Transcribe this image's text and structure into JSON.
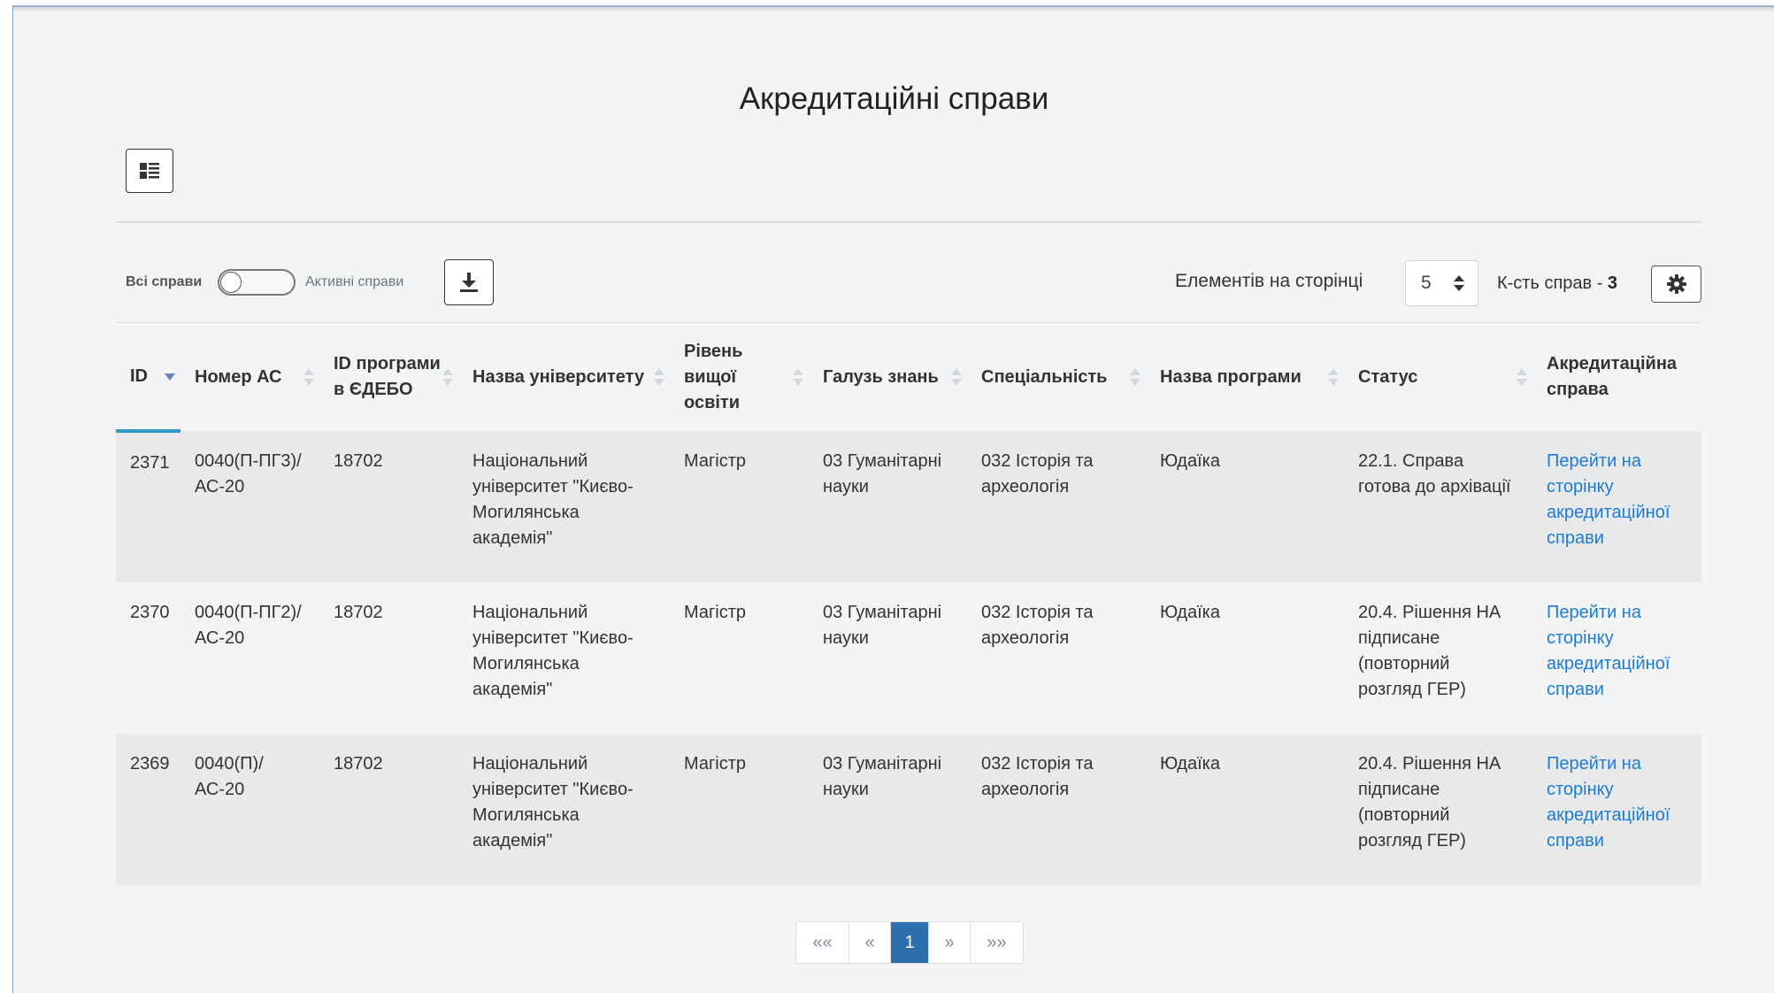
{
  "page": {
    "title": "Акредитаційні справи"
  },
  "toolbar": {
    "all_cases_label": "Всі справи",
    "active_cases_label": "Активні справи",
    "per_page_label": "Елементів на сторінці",
    "per_page_value": "5",
    "count_label": "К-сть справ - ",
    "count_value": "3",
    "icons": {
      "list": "list-view-icon",
      "download": "download-icon",
      "settings": "gear-icon"
    }
  },
  "table": {
    "columns": [
      "ID",
      "Номер АС",
      "ID програми в ЄДЕБО",
      "Назва університету",
      "Рівень вищої освіти",
      "Галузь знань",
      "Спеціальність",
      "Назва програми",
      "Статус",
      "Акредитаційна справа"
    ],
    "rows": [
      {
        "id": "2371",
        "case_number": "0040(П-ПГ3)/АС-20",
        "edebo_id": "18702",
        "university": "Національний університет \"Києво-Могилянська академія\"",
        "level": "Магістр",
        "field": "03 Гуманітарні науки",
        "specialty": "032 Історія та археологія",
        "program": "Юдаїка",
        "status": "22.1. Справа готова до архівації",
        "link": "Перейти на сторінку акредитаційної справи"
      },
      {
        "id": "2370",
        "case_number": "0040(П-ПГ2)/АС-20",
        "edebo_id": "18702",
        "university": "Національний університет \"Києво-Могилянська академія\"",
        "level": "Магістр",
        "field": "03 Гуманітарні науки",
        "specialty": "032 Історія та археологія",
        "program": "Юдаїка",
        "status": "20.4. Рішення НА підписане (повторний розгляд ГЕР)",
        "link": "Перейти на сторінку акредитаційної справи"
      },
      {
        "id": "2369",
        "case_number": "0040(П)/АС-20",
        "edebo_id": "18702",
        "university": "Національний університет \"Києво-Могилянська академія\"",
        "level": "Магістр",
        "field": "03 Гуманітарні науки",
        "specialty": "032 Історія та археологія",
        "program": "Юдаїка",
        "status": "20.4. Рішення НА підписане (повторний розгляд ГЕР)",
        "link": "Перейти на сторінку акредитаційної справи"
      }
    ]
  },
  "pagination": {
    "first": "««",
    "prev": "«",
    "current": "1",
    "next": "»",
    "last": "»»"
  },
  "colors": {
    "accent": "#2e9ac7",
    "link": "#1e7bd6",
    "page_active": "#2e6fb0",
    "row_odd": "#e7e9eb"
  }
}
